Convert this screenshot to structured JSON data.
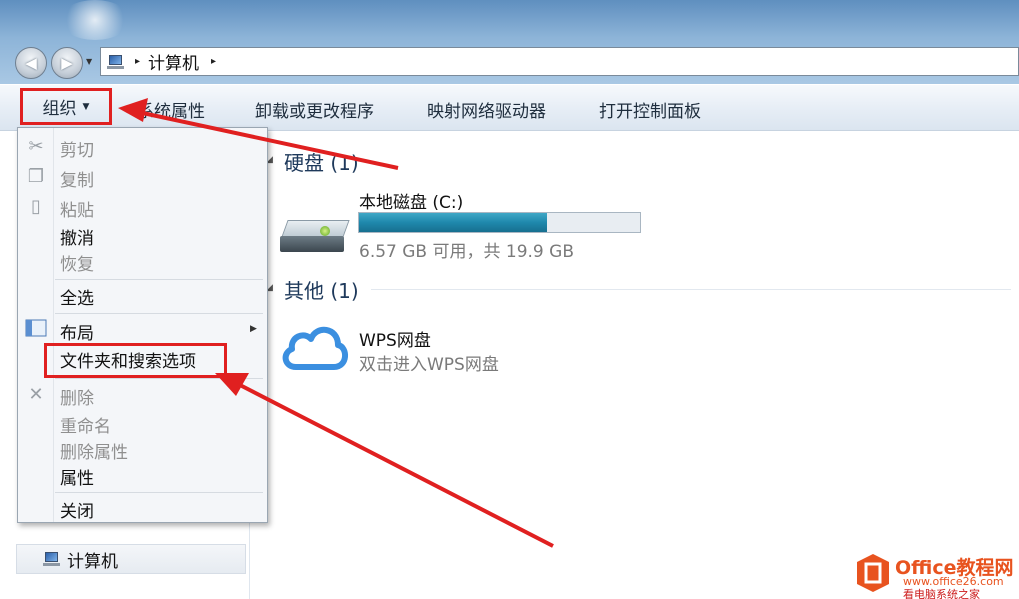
{
  "address_bar": {
    "crumb_separator": "▸",
    "location": "计算机",
    "trailing_separator": "▸"
  },
  "toolbar": {
    "organize_label": "组织",
    "items": [
      "系统属性",
      "卸载或更改程序",
      "映射网络驱动器",
      "打开控制面板"
    ]
  },
  "organize_menu": {
    "items": [
      {
        "label": "剪切",
        "enabled": false,
        "icon": "scissors-icon"
      },
      {
        "label": "复制",
        "enabled": false,
        "icon": "copy-icon"
      },
      {
        "label": "粘贴",
        "enabled": false,
        "icon": "paste-icon"
      },
      {
        "label": "撤消",
        "enabled": true
      },
      {
        "label": "恢复",
        "enabled": false
      },
      {
        "label": "全选",
        "enabled": true
      },
      {
        "label": "布局",
        "enabled": true,
        "icon": "layout-icon",
        "submenu": true
      },
      {
        "label": "文件夹和搜索选项",
        "enabled": true,
        "highlighted": true
      },
      {
        "label": "删除",
        "enabled": false,
        "icon": "delete-icon"
      },
      {
        "label": "重命名",
        "enabled": false
      },
      {
        "label": "删除属性",
        "enabled": false
      },
      {
        "label": "属性",
        "enabled": true
      },
      {
        "label": "关闭",
        "enabled": true
      }
    ]
  },
  "content": {
    "groups": [
      {
        "title": "硬盘 (1)"
      },
      {
        "title": "其他 (1)"
      }
    ],
    "drive": {
      "name": "本地磁盘 (C:)",
      "info": "6.57 GB 可用，共 19.9 GB",
      "used_fraction": 0.67
    },
    "wps": {
      "name": "WPS网盘",
      "description": "双击进入WPS网盘"
    }
  },
  "navpane": {
    "computer_label": "计算机"
  },
  "watermark": {
    "brand": "Office教程网",
    "url": "www.office26.com",
    "site": "看电脑系统之家"
  },
  "colors": {
    "annotation_red": "#e02020",
    "drive_bar": "#1f88ac",
    "wps_cloud": "#3b8fe0"
  }
}
